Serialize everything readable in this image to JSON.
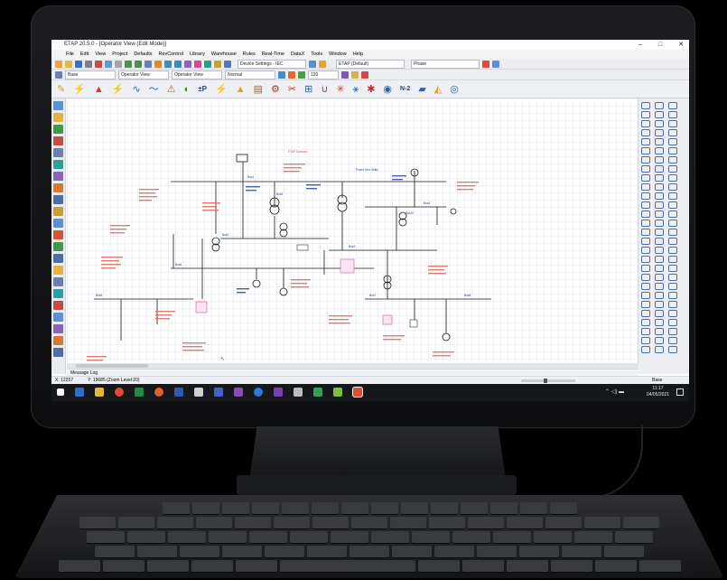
{
  "window": {
    "title": "ETAP 20.5.0 - [Operator View (Edit Mode)]",
    "buttons": [
      "–",
      "□",
      "✕"
    ]
  },
  "menu": [
    "File",
    "Edit",
    "View",
    "Project",
    "Defaults",
    "RevControl",
    "Library",
    "Warehouse",
    "Rules",
    "Real-Time",
    "DataX",
    "Tools",
    "Window",
    "Help"
  ],
  "toolbar1": {
    "device_settings": "Device Settings - IEC",
    "etap_default": "ETAP (Default)",
    "phase": "Phase"
  },
  "toolbar2": {
    "base": "Base",
    "operator_view_1": "Operator View",
    "operator_view_2": "Operator View",
    "normal": "Normal",
    "study_value": "120"
  },
  "toolbar3": {
    "labels": [
      "±P",
      "N-2"
    ]
  },
  "diagram": {
    "bus_labels": [
      "Bus1",
      "Bus2",
      "Bus3",
      "Bus4",
      "Bus5",
      "Bus6",
      "Bus7",
      "Bus8",
      "Bus9",
      "Bus10"
    ],
    "red_note": "ETAP Scenario",
    "blue_note": "Power Grid Utility"
  },
  "message_log": "Message Log",
  "status": {
    "x": "X: 12257",
    "y": "Y: 19685 (Zoom Level 20)",
    "base": "Base"
  },
  "clock": {
    "time": "11:17",
    "date": "04/05/2021"
  },
  "colors": {
    "accent": "#1f3f8f",
    "red_text": "#d9534f",
    "taskbar": "#16181c"
  }
}
